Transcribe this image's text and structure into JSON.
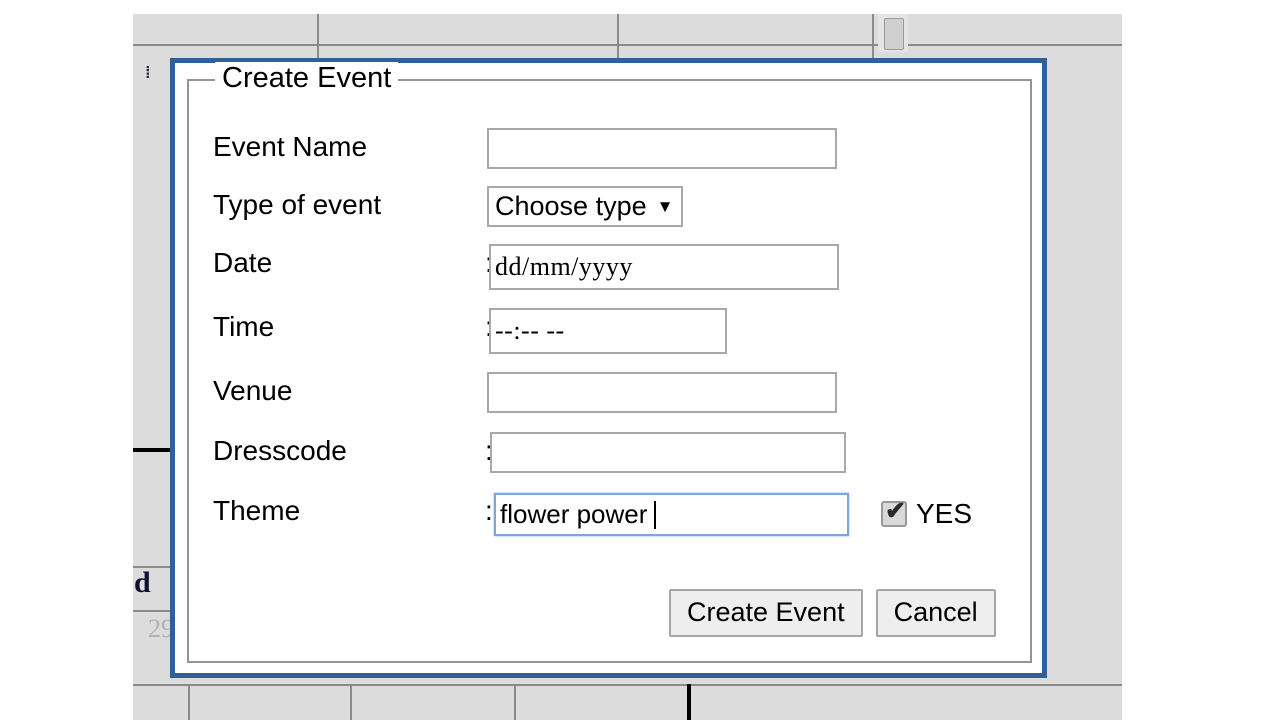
{
  "background": {
    "page_bg_color": "#dcdcdc",
    "table_note": "partially obscured data table grid behind the modal",
    "stray_texts": [
      {
        "name": "row-number",
        "text": "29"
      },
      {
        "name": "bold-char",
        "text": "d"
      }
    ],
    "icon_dots": "⁞"
  },
  "dialog": {
    "border_color": "#2e6099",
    "legend": "Create Event",
    "fields": [
      {
        "name": "event-name",
        "label": "Event Name",
        "colon": ":",
        "value": "",
        "placeholder": ""
      },
      {
        "name": "type-of-event",
        "label": "Type of event",
        "colon": ":",
        "selected": "Choose type",
        "arrow": "▼"
      },
      {
        "name": "date",
        "label": "Date",
        "colon": ":",
        "value": "",
        "placeholder": "dd/mm/yyyy"
      },
      {
        "name": "time",
        "label": "Time",
        "colon": ":",
        "value": "",
        "placeholder": "--:-- --"
      },
      {
        "name": "venue",
        "label": "Venue",
        "colon": ":",
        "value": "",
        "placeholder": ""
      },
      {
        "name": "dresscode",
        "label": "Dresscode",
        "colon": ":",
        "value": "",
        "placeholder": ""
      },
      {
        "name": "theme",
        "label": "Theme",
        "colon": ":",
        "value": "flower power",
        "placeholder": ""
      }
    ],
    "theme_checkbox": {
      "label": "YES",
      "checked": true,
      "tick_glyph": "✔"
    },
    "buttons": {
      "submit": "Create Event",
      "cancel": "Cancel"
    }
  }
}
